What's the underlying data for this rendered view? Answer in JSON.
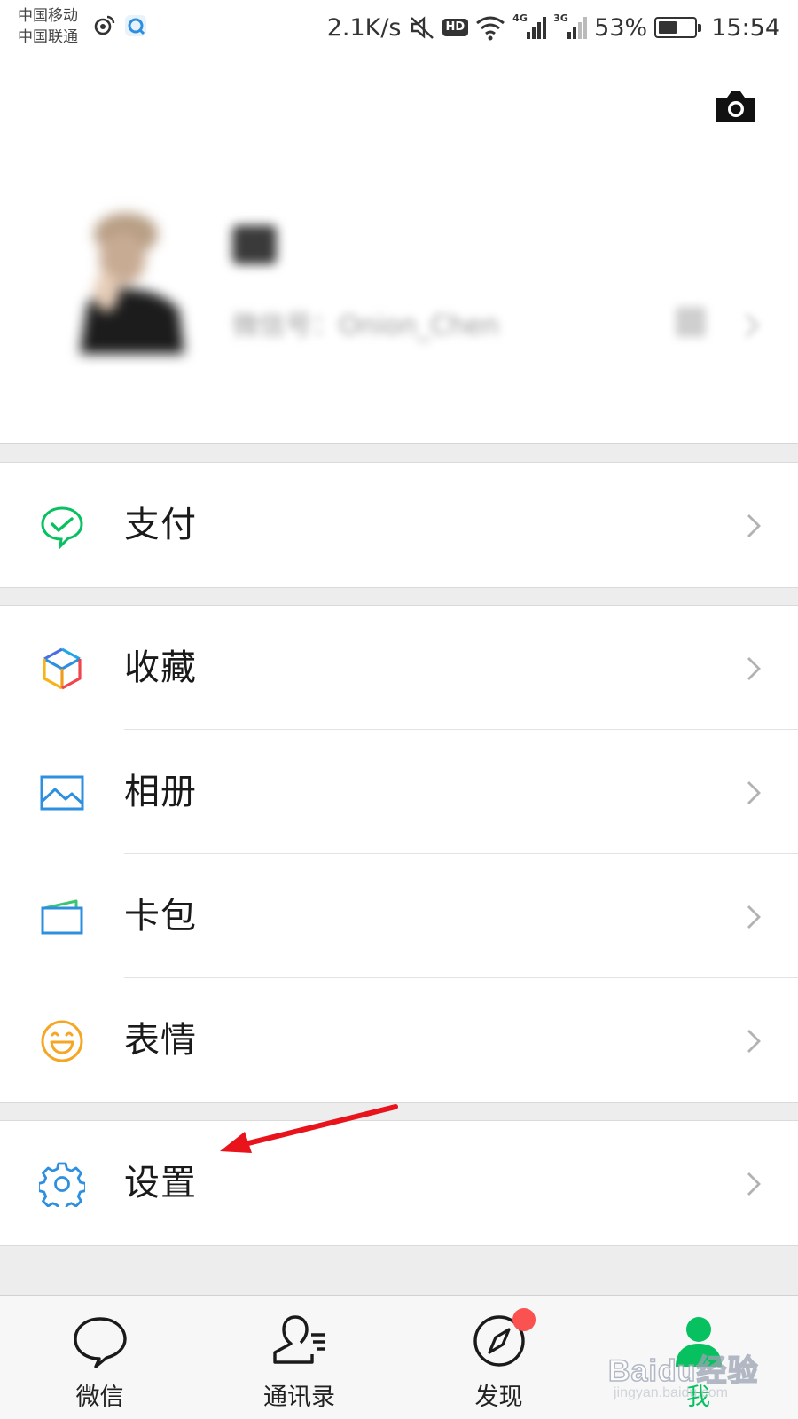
{
  "status_bar": {
    "carrier_1": "中国移动",
    "carrier_2": "中国联通",
    "speed": "2.1K/s",
    "hd": "HD",
    "network_1": "4G",
    "network_2": "3G",
    "battery": "53%",
    "battery_level": 0.53,
    "time": "15:54"
  },
  "profile": {
    "wechat_id": "微信号：Onion_Chen"
  },
  "menu": {
    "pay": "支付",
    "favorites": "收藏",
    "album": "相册",
    "cards": "卡包",
    "stickers": "表情",
    "settings": "设置"
  },
  "bottom_nav": {
    "chats": "微信",
    "contacts": "通讯录",
    "discover": "发现",
    "me": "我"
  },
  "watermark": {
    "main": "Baidu经验",
    "sub": "jingyan.baidu.com"
  },
  "colors": {
    "wechat_green": "#07c160",
    "badge_red": "#fa5151",
    "icon_blue": "#2d8fe0",
    "annotation_red": "#e8131b"
  }
}
